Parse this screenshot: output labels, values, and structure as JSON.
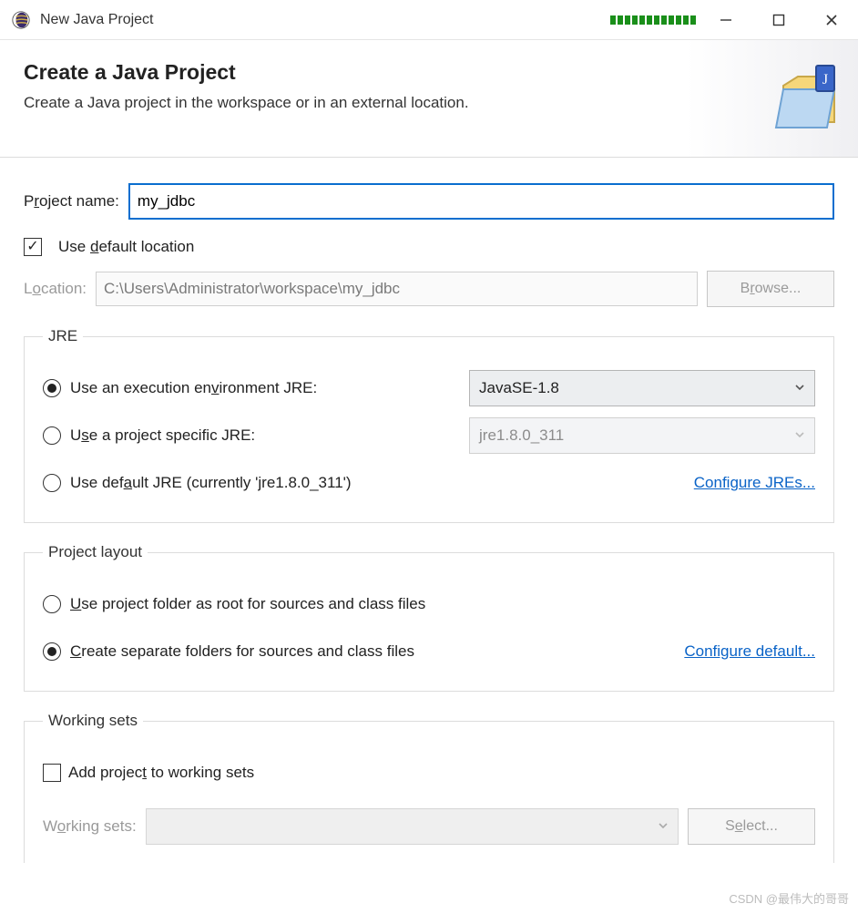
{
  "titlebar": {
    "title": "New Java Project"
  },
  "banner": {
    "heading": "Create a Java Project",
    "subheading": "Create a Java project in the workspace or in an external location."
  },
  "project": {
    "name_label_pre": "P",
    "name_label_u": "r",
    "name_label_post": "oject name:",
    "name_value": "my_jdbc",
    "use_default_pre": "Use ",
    "use_default_u": "d",
    "use_default_post": "efault location",
    "location_label_pre": "L",
    "location_label_u": "o",
    "location_label_post": "cation:",
    "location_value": "C:\\Users\\Administrator\\workspace\\my_jdbc",
    "browse_pre": "B",
    "browse_u": "r",
    "browse_post": "owse..."
  },
  "jre": {
    "legend": "JRE",
    "opt1_pre": "Use an execution en",
    "opt1_u": "v",
    "opt1_post": "ironment JRE:",
    "env_selected": "JavaSE-1.8",
    "opt2_pre": "U",
    "opt2_u": "s",
    "opt2_post": "e a project specific JRE:",
    "specific_selected": "jre1.8.0_311",
    "opt3_pre": "Use def",
    "opt3_u": "a",
    "opt3_post": "ult JRE  (currently 'jre1.8.0_311')",
    "configure_link": "Configure JREs..."
  },
  "layout": {
    "legend": "Project layout",
    "opt1_pre": "",
    "opt1_u": "U",
    "opt1_post": "se project folder as root for sources and class files",
    "opt2_pre": "",
    "opt2_u": "C",
    "opt2_post": "reate separate folders for sources and class files",
    "configure_link": "Configure default..."
  },
  "working_sets": {
    "legend": "Working sets",
    "add_pre": "Add projec",
    "add_u": "t",
    "add_post": " to working sets",
    "label_pre": "W",
    "label_u": "o",
    "label_post": "rking sets:",
    "select_pre": "S",
    "select_u": "e",
    "select_post": "lect..."
  },
  "watermark": "CSDN @最伟大的哥哥"
}
